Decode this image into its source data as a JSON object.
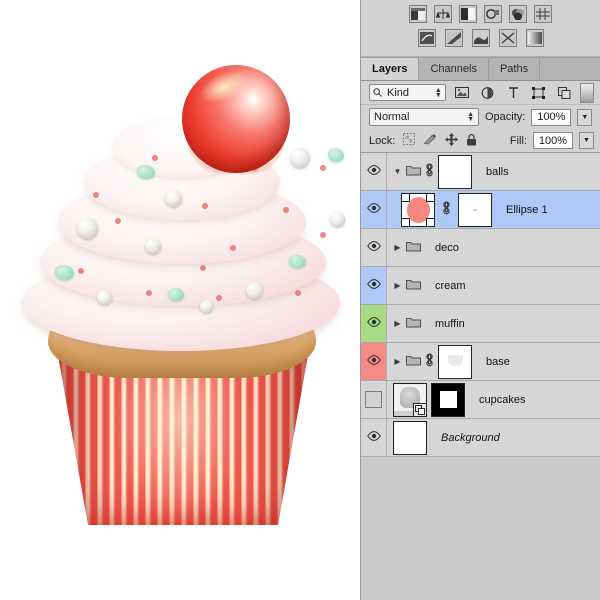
{
  "app": {
    "name": "Photoshop Layers Panel",
    "artwork": "cupcake-illustration"
  },
  "toolbar": {
    "row1": [
      {
        "name": "brightness-contrast-icon",
        "label": "Brightness/Contrast"
      },
      {
        "name": "levels-icon",
        "label": "Levels"
      },
      {
        "name": "curves-icon",
        "label": "Curves"
      },
      {
        "name": "exposure-icon",
        "label": "Exposure"
      },
      {
        "name": "vibrance-icon",
        "label": "Vibrance"
      },
      {
        "name": "hue-saturation-icon",
        "label": "Hue/Saturation"
      }
    ],
    "row2": [
      {
        "name": "color-balance-icon",
        "label": "Color Balance"
      },
      {
        "name": "black-white-icon",
        "label": "Black & White"
      },
      {
        "name": "photo-filter-icon",
        "label": "Photo Filter"
      },
      {
        "name": "channel-mixer-icon",
        "label": "Channel Mixer"
      },
      {
        "name": "gradient-map-icon",
        "label": "Gradient Map"
      }
    ]
  },
  "tabs": [
    {
      "label": "Layers",
      "active": true
    },
    {
      "label": "Channels",
      "active": false
    },
    {
      "label": "Paths",
      "active": false
    }
  ],
  "filter": {
    "kind_label": "Kind",
    "search_icon": "search-icon",
    "buttons": [
      {
        "name": "filter-pixel-icon",
        "glyph": "ὛC"
      },
      {
        "name": "filter-adjustment-icon",
        "glyph": "◑"
      },
      {
        "name": "filter-type-icon",
        "glyph": "T"
      },
      {
        "name": "filter-shape-icon",
        "glyph": "⬚"
      },
      {
        "name": "filter-smart-object-icon",
        "glyph": "⧉"
      }
    ],
    "toggle_name": "filter-enable-toggle"
  },
  "blend": {
    "mode": "Normal",
    "opacity_label": "Opacity:",
    "opacity_value": "100%"
  },
  "lock": {
    "label": "Lock:",
    "icons": [
      {
        "name": "lock-transparent-pixels-icon"
      },
      {
        "name": "lock-image-pixels-icon"
      },
      {
        "name": "lock-position-icon"
      },
      {
        "name": "lock-all-icon"
      }
    ],
    "fill_label": "Fill:",
    "fill_value": "100%"
  },
  "layers": [
    {
      "name": "balls",
      "type": "group",
      "visible": true,
      "expanded": true,
      "selected": false,
      "indent": 0,
      "eye_color": "#d6d6d6",
      "has_link": true,
      "thumb": "white",
      "italic": false
    },
    {
      "name": "Ellipse 1",
      "type": "shape",
      "visible": true,
      "expanded": null,
      "selected": true,
      "indent": 1,
      "eye_color": "#aec8f7",
      "has_link": true,
      "thumb": "ellipse-pink",
      "italic": false
    },
    {
      "name": "deco",
      "type": "group",
      "visible": true,
      "expanded": false,
      "selected": false,
      "indent": 0,
      "eye_color": "#d6d6d6",
      "has_link": false,
      "thumb": "none",
      "italic": false
    },
    {
      "name": "cream",
      "type": "group",
      "visible": true,
      "expanded": false,
      "selected": false,
      "indent": 0,
      "eye_color": "#aec8f7",
      "has_link": false,
      "thumb": "none",
      "italic": false
    },
    {
      "name": "muffin",
      "type": "group",
      "visible": true,
      "expanded": false,
      "selected": false,
      "indent": 0,
      "eye_color": "#a6dc84",
      "has_link": false,
      "thumb": "none",
      "italic": false
    },
    {
      "name": "base",
      "type": "group",
      "visible": true,
      "expanded": false,
      "selected": false,
      "indent": 0,
      "eye_color": "#f58a85",
      "has_link": true,
      "thumb": "white-soft",
      "italic": false
    },
    {
      "name": "cupcakes",
      "type": "smart-object",
      "visible": false,
      "expanded": null,
      "selected": false,
      "indent": 0,
      "eye_color": "#d6d6d6",
      "has_link": false,
      "thumb": "smart-object",
      "mask": "black-white-square",
      "italic": false
    },
    {
      "name": "Background",
      "type": "background",
      "visible": true,
      "expanded": null,
      "selected": false,
      "indent": 0,
      "eye_color": "#d6d6d6",
      "has_link": false,
      "thumb": "white",
      "italic": true
    }
  ],
  "colors": {
    "panel_bg": "#d2d2d2",
    "row_bg": "#d6d6d6",
    "selection": "#aec8f7",
    "label_blue": "#aec8f7",
    "label_green": "#a6dc84",
    "label_red": "#f58a85",
    "empty_bg": "#c9c9c9",
    "cherry_red": "#ec3b2c",
    "wrapper_red": "#ef5a50",
    "cake_tan": "#e2b57f",
    "mint_green": "#a9e2c9",
    "sprinkle_pink": "#e0736f"
  }
}
